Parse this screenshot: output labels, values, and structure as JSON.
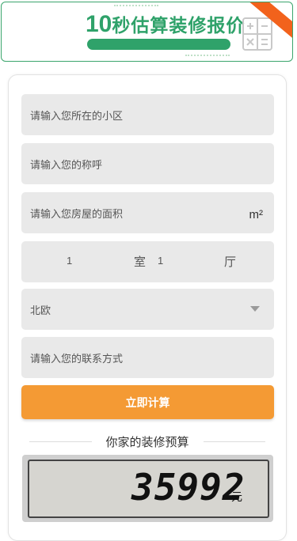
{
  "banner": {
    "title_num": "10",
    "title_text": "秒估算装修报价"
  },
  "form": {
    "community_placeholder": "请输入您所在的小区",
    "name_placeholder": "请输入您的称呼",
    "area_placeholder": "请输入您房屋的面积",
    "area_unit": "m²",
    "rooms_value": "1",
    "rooms_label": "室",
    "halls_value": "1",
    "halls_label": "厅",
    "style_selected": "北欧",
    "contact_placeholder": "请输入您的联系方式",
    "calc_button": "立即计算"
  },
  "budget": {
    "title": "你家的装修预算",
    "amount": "35992",
    "unit": "元"
  },
  "colors": {
    "green": "#2fa26a",
    "orange_button": "#f49a34",
    "ribbon": "#f2621c"
  }
}
